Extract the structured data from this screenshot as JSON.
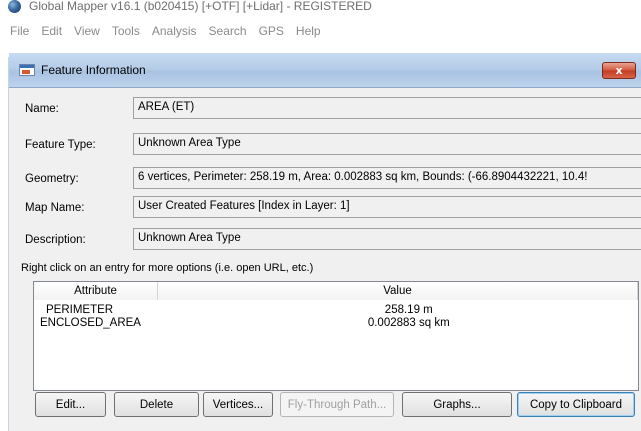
{
  "app": {
    "title": "Global Mapper v16.1 (b020415) [+OTF] [+Lidar] - REGISTERED",
    "menu": [
      "File",
      "Edit",
      "View",
      "Tools",
      "Analysis",
      "Search",
      "GPS",
      "Help"
    ]
  },
  "dialog": {
    "title": "Feature Information",
    "close_label": "x",
    "fields": {
      "name": {
        "label": "Name:",
        "value": "AREA   (ET)"
      },
      "feature_type": {
        "label": "Feature Type:",
        "value": "Unknown Area Type"
      },
      "geometry": {
        "label": "Geometry:",
        "value": "6 vertices, Perimeter: 258.19 m, Area: 0.002883 sq km, Bounds: (-66.8904432221, 10.4!"
      },
      "map_name": {
        "label": "Map Name:",
        "value": "User Created Features [Index in Layer: 1]"
      },
      "description": {
        "label": "Description:",
        "value": "Unknown Area Type"
      }
    },
    "hint": "Right click on an entry for more options (i.e. open URL, etc.)",
    "attributes": {
      "headers": [
        "Attribute",
        "Value"
      ],
      "rows": [
        {
          "attribute": "PERIMETER",
          "value": "258.19 m"
        },
        {
          "attribute": "ENCLOSED_AREA",
          "value": "0.002883 sq km"
        }
      ]
    },
    "buttons": {
      "edit": "Edit...",
      "delete": "Delete",
      "vertices": "Vertices...",
      "fly_through": "Fly-Through Path...",
      "graphs": "Graphs...",
      "copy": "Copy to Clipboard"
    }
  }
}
